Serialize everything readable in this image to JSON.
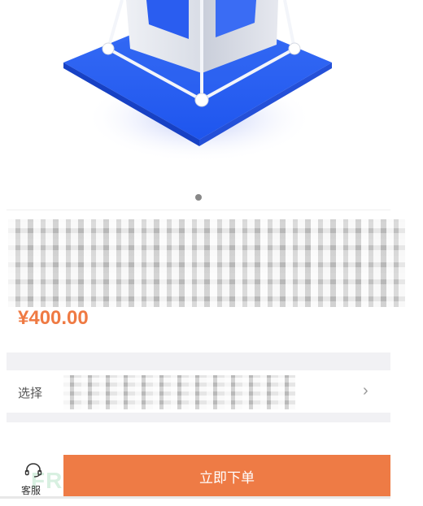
{
  "hero": {
    "icon": "blue-isometric-cube-illustration",
    "pager_dots": 1,
    "active_dot": 1
  },
  "product": {
    "title": "",
    "price": "¥400.00"
  },
  "select_row": {
    "label": "选择",
    "value": "",
    "chevron_icon": "chevron-right-icon"
  },
  "bottom_bar": {
    "customer_service_label": "客服",
    "customer_service_icon": "headset-icon",
    "order_button_label": "立即下单",
    "watermark": "FREEBUF"
  },
  "colors": {
    "accent": "#ee7b45",
    "price": "#ef7a43",
    "illustration_blue": "#1f5bf0",
    "band": "#f1f1f4"
  }
}
